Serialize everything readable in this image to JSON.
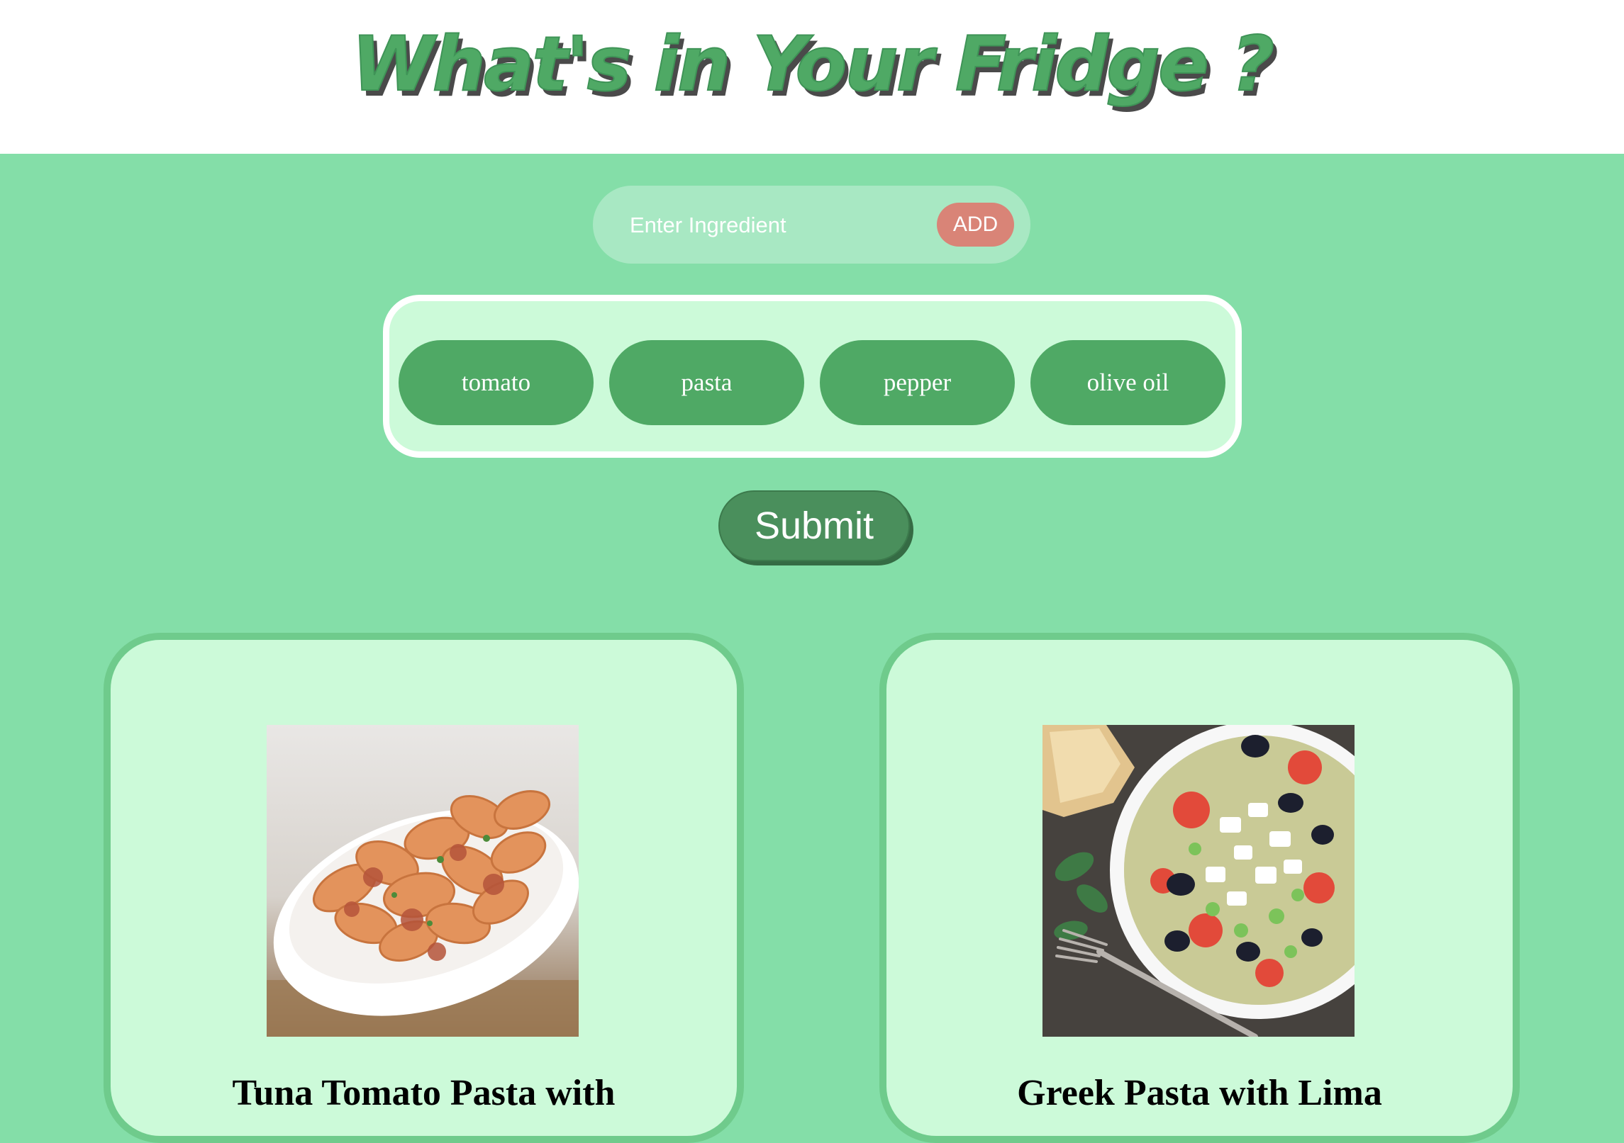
{
  "header": {
    "title": "What's in Your Fridge ?"
  },
  "search": {
    "placeholder": "Enter Ingredient",
    "add_label": "ADD"
  },
  "ingredients": [
    "tomato",
    "pasta",
    "pepper",
    "olive oil"
  ],
  "submit_label": "Submit",
  "recipes": [
    {
      "title": "Tuna Tomato Pasta with"
    },
    {
      "title": "Greek Pasta with Lima"
    }
  ],
  "colors": {
    "background": "#84dea8",
    "accent": "#4fa965",
    "add_button": "#d98477",
    "card_background": "#ccfad9",
    "submit": "#4a8f5c"
  }
}
